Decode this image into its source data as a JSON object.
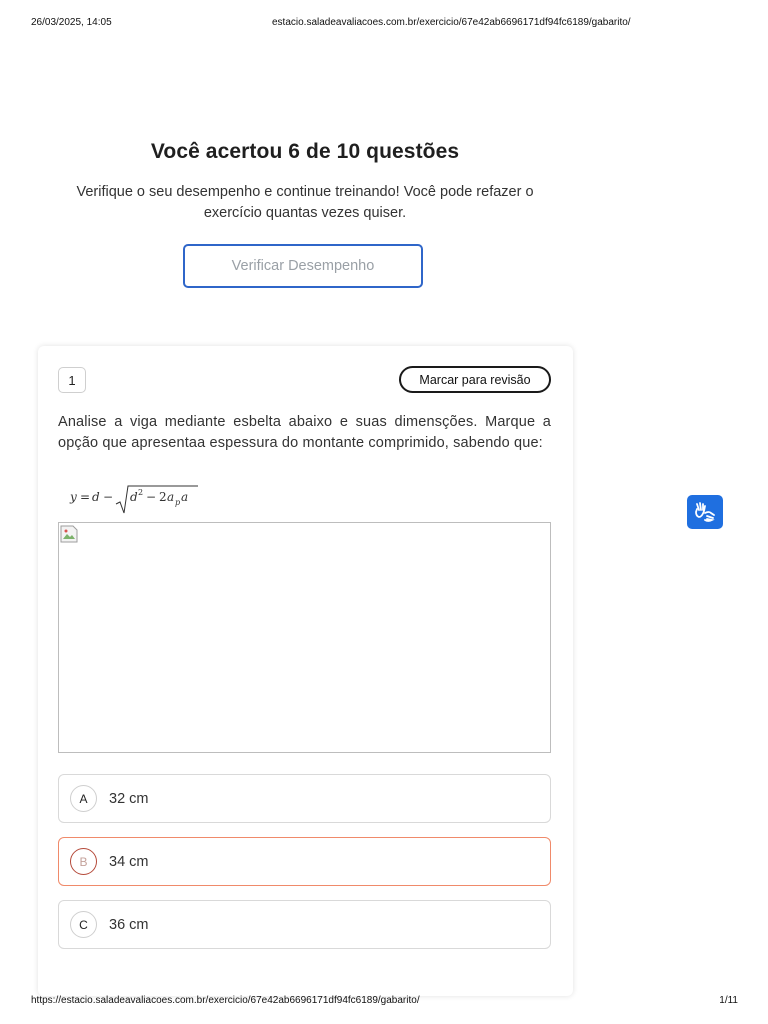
{
  "print_header": {
    "datetime": "26/03/2025, 14:05",
    "url": "estacio.saladeavaliacoes.com.br/exercicio/67e42ab6696171df94fc6189/gabarito/"
  },
  "result": {
    "title": "Você acertou 6 de 10 questões",
    "subtitle": "Verifique o seu desempenho e continue treinando! Você pode refazer o exercício quantas vezes quiser.",
    "button_label": "Verificar Desempenho"
  },
  "question": {
    "number": "1",
    "review_label": "Marcar para revisão",
    "statement": "Analise a viga mediante esbelta abaixo e suas dimensções. Marque a opção que apresentaa espessura do montante comprimido, sabendo que:",
    "options": [
      {
        "letter": "A",
        "text": "32 cm",
        "state": "default"
      },
      {
        "letter": "B",
        "text": "34 cm",
        "state": "wrong"
      },
      {
        "letter": "C",
        "text": "36 cm",
        "state": "default"
      }
    ]
  },
  "accessibility": {
    "icon": "vlibras-hands-icon",
    "color": "#1f6fe0"
  },
  "colors": {
    "accent": "#2f66c9",
    "wrong": "#f08a6a"
  },
  "print_footer": {
    "url": "https://estacio.saladeavaliacoes.com.br/exercicio/67e42ab6696171df94fc6189/gabarito/",
    "page": "1/11"
  }
}
